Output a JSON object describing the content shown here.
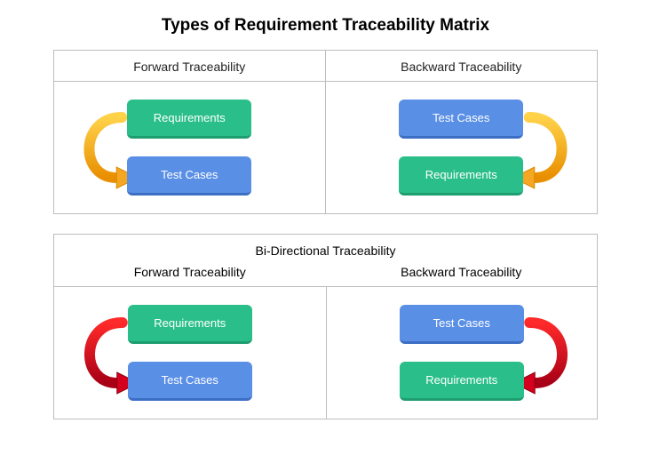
{
  "title": "Types of Requirement Traceability Matrix",
  "top": {
    "left": {
      "header": "Forward Traceability",
      "block_top": "Requirements",
      "block_bottom": "Test Cases",
      "arrow_color": "#f5a623",
      "arrow_fill": "#ffbe3d",
      "arrow_side": "left"
    },
    "right": {
      "header": "Backward Traceability",
      "block_top": "Test Cases",
      "block_bottom": "Requirements",
      "arrow_color": "#f5a623",
      "arrow_fill": "#ffbe3d",
      "arrow_side": "right"
    }
  },
  "bidir": {
    "header": "Bi-Directional Traceability",
    "left": {
      "sub": "Forward Traceability",
      "block_top": "Requirements",
      "block_bottom": "Test Cases",
      "arrow_color": "#b3001b",
      "arrow_fill": "#e1001f",
      "arrow_side": "left"
    },
    "right": {
      "sub": "Backward Traceability",
      "block_top": "Test Cases",
      "block_bottom": "Requirements",
      "arrow_color": "#b3001b",
      "arrow_fill": "#e1001f",
      "arrow_side": "right"
    }
  }
}
